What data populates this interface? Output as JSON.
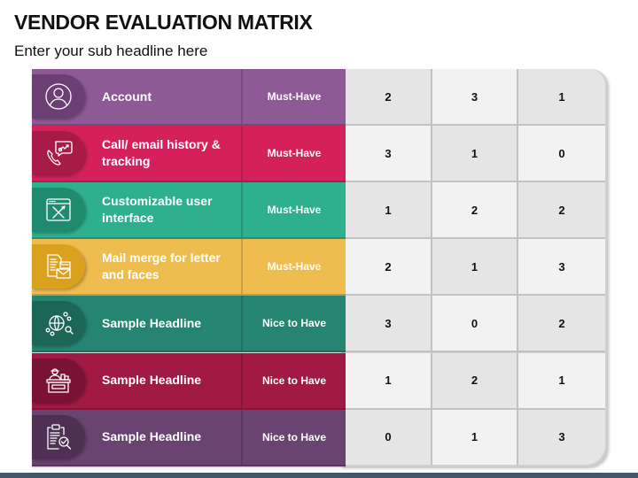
{
  "header": {
    "title": "VENDOR EVALUATION MATRIX",
    "subtitle": "Enter your sub headline here"
  },
  "rows": [
    {
      "label": "Account",
      "category": "Must-Have",
      "scores": [
        "2",
        "3",
        "1"
      ],
      "icon": "user-account-icon",
      "color": "#8e5a96",
      "tab_color": "#6b3f73"
    },
    {
      "label": "Call/ email history & tracking",
      "category": "Must-Have",
      "scores": [
        "3",
        "1",
        "0"
      ],
      "icon": "phone-chat-tracking-icon",
      "color": "#d4215b",
      "tab_color": "#a81a48"
    },
    {
      "label": "Customizable user interface",
      "category": "Must-Have",
      "scores": [
        "1",
        "2",
        "2"
      ],
      "icon": "browser-tools-icon",
      "color": "#2eb08f",
      "tab_color": "#208a6f"
    },
    {
      "label": "Mail merge for letter and faces",
      "category": "Must-Have",
      "scores": [
        "2",
        "1",
        "3"
      ],
      "icon": "mail-document-icon",
      "color": "#efbd4f",
      "tab_color": "#d9a11d"
    },
    {
      "label": "Sample Headline",
      "category": "Nice to Have",
      "scores": [
        "3",
        "0",
        "2"
      ],
      "icon": "globe-network-search-icon",
      "color": "#258572",
      "tab_color": "#1b6657"
    },
    {
      "label": "Sample Headline",
      "category": "Nice to Have",
      "scores": [
        "1",
        "2",
        "1"
      ],
      "icon": "vendor-stall-icon",
      "color": "#a01a45",
      "tab_color": "#7a1235"
    },
    {
      "label": "Sample Headline",
      "category": "Nice to Have",
      "scores": [
        "0",
        "1",
        "3"
      ],
      "icon": "clipboard-check-icon",
      "color": "#6a4470",
      "tab_color": "#4f3054"
    }
  ],
  "colors": {
    "grid_dark": "#e5e5e5",
    "grid_light": "#f2f2f2",
    "bottom_bar": "#44546a"
  }
}
